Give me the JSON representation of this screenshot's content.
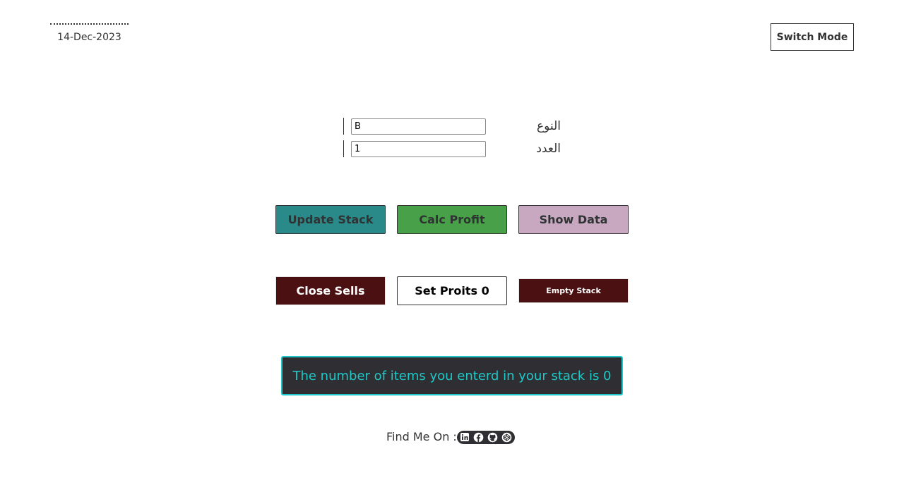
{
  "header": {
    "date": "14-Dec-2023",
    "switch_mode_label": "Switch Mode"
  },
  "form": {
    "type_label": "النوع",
    "type_value": "B",
    "count_label": "العدد",
    "count_value": "1"
  },
  "actions_row_1": {
    "update_stack": "Update Stack",
    "calc_profit": "Calc Profit",
    "show_data": "Show Data"
  },
  "actions_row_2": {
    "close_sells": "Close Sells",
    "set_profits": "Set Proits 0",
    "empty_stack": "Empty Stack"
  },
  "status": {
    "message": "The number of items you enterd in your stack is 0"
  },
  "footer": {
    "label": "Find Me On :",
    "social_icons": [
      "linkedin-icon",
      "facebook-icon",
      "github-icon",
      "codepen-icon"
    ]
  },
  "colors": {
    "update_bg": "#2a8a8a",
    "calc_bg": "#48a048",
    "show_bg": "#c8a8c0",
    "danger_bg": "#4a1012",
    "status_bg": "#2f2f33",
    "status_accent": "#1fc8c8"
  }
}
